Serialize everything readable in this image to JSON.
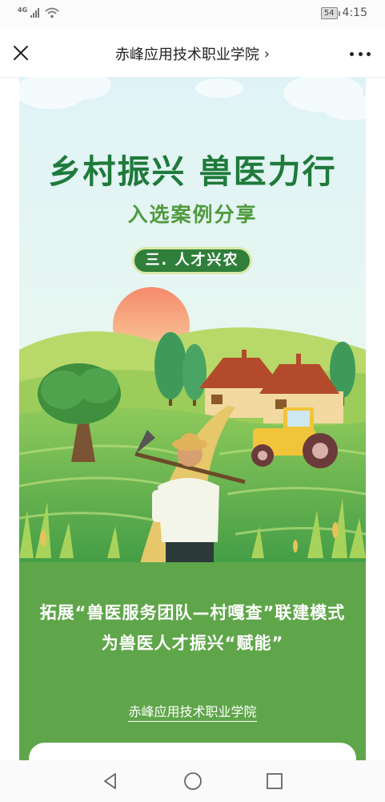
{
  "status": {
    "network": "4G",
    "battery": "54",
    "time": "4:15"
  },
  "nav": {
    "title": "赤峰应用技术职业学院",
    "chevron": "›"
  },
  "poster": {
    "title": "乡村振兴 兽医力行",
    "subtitle": "入选案例分享",
    "badge": "三. 人才兴农",
    "line1": "拓展“兽医服务团队—村嘎查”联建模式",
    "line2": "为兽医人才振兴“赋能”",
    "footer": "赤峰应用技术职业学院"
  },
  "icons": {
    "close": "close-icon",
    "more": "more-icon",
    "back": "back-triangle-icon",
    "home": "home-circle-icon",
    "recent": "recent-square-icon"
  },
  "colors": {
    "title_green": "#1f7a3b",
    "subtitle_green": "#4f9a3d",
    "badge_green": "#2f7f3a",
    "poster_green": "#5fa64a"
  }
}
